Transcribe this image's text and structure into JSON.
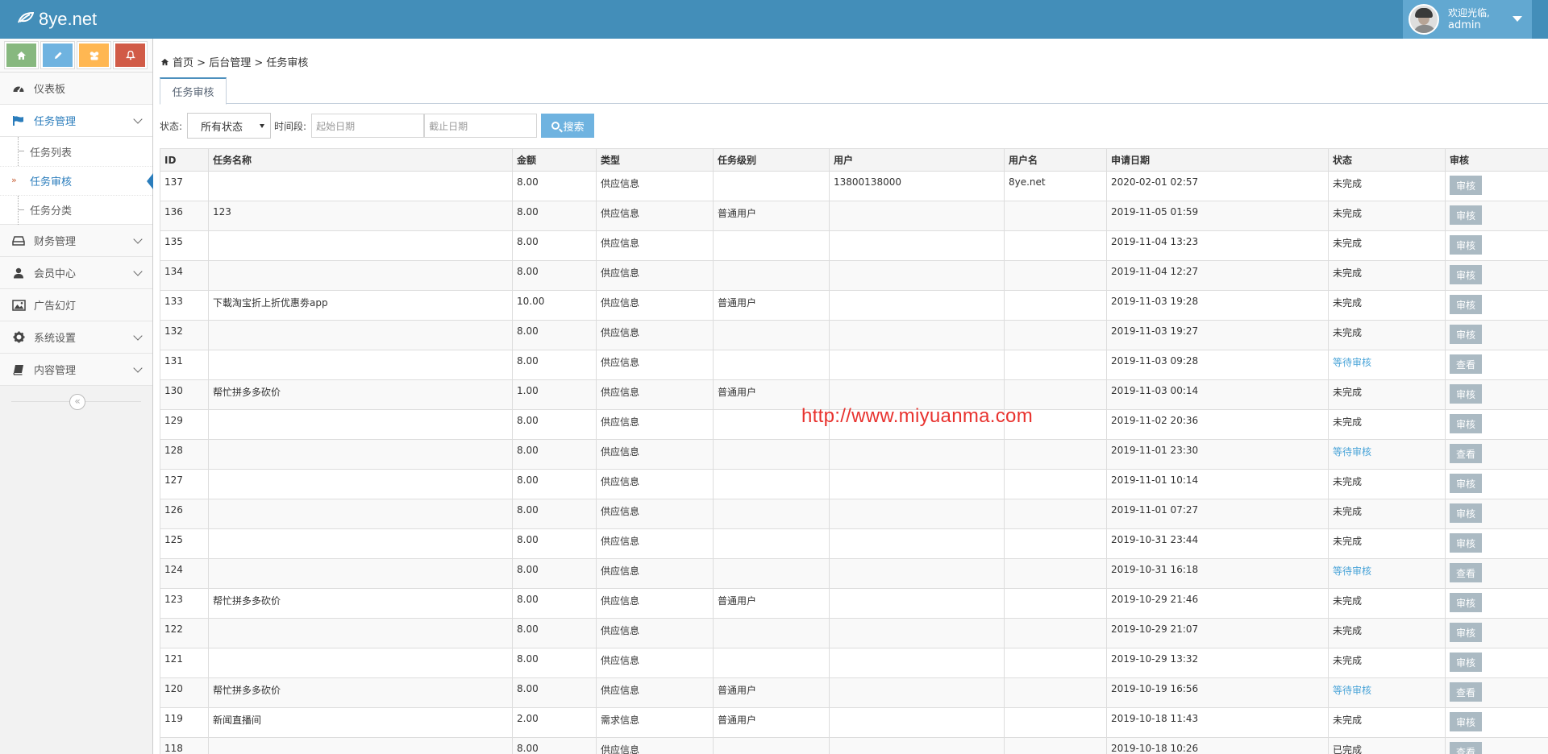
{
  "app": {
    "brand": "8ye.net"
  },
  "user": {
    "welcome": "欢迎光临,",
    "name": "admin"
  },
  "shortcuts": [
    "home-icon",
    "pencil-icon",
    "users-icon",
    "bell-icon"
  ],
  "sidebar": {
    "items": [
      {
        "label": "仪表板"
      },
      {
        "label": "任务管理"
      },
      {
        "label": "财务管理"
      },
      {
        "label": "会员中心"
      },
      {
        "label": "广告幻灯"
      },
      {
        "label": "系统设置"
      },
      {
        "label": "内容管理"
      }
    ],
    "sub": [
      "任务列表",
      "任务审核",
      "任务分类"
    ]
  },
  "breadcrumb": {
    "home": "首页",
    "sep1": ">",
    "level1": "后台管理",
    "sep2": ">",
    "current": "任务审核"
  },
  "tab": {
    "label": "任务审核"
  },
  "filter": {
    "status_label": "状态:",
    "status_value": "所有状态",
    "period_label": "时间段:",
    "start_placeholder": "起始日期",
    "end_placeholder": "截止日期",
    "search_label": "搜索"
  },
  "table": {
    "headers": [
      "ID",
      "任务名称",
      "金额",
      "类型",
      "任务级别",
      "用户",
      "用户名",
      "申请日期",
      "状态",
      "审核"
    ],
    "rows": [
      [
        "137",
        "",
        "8.00",
        "供应信息",
        "",
        "13800138000",
        "8ye.net",
        "2020-02-01 02:57",
        "未完成",
        "审核"
      ],
      [
        "136",
        "123",
        "8.00",
        "供应信息",
        "普通用户",
        "",
        "",
        "2019-11-05 01:59",
        "未完成",
        "审核"
      ],
      [
        "135",
        "",
        "8.00",
        "供应信息",
        "",
        "",
        "",
        "2019-11-04 13:23",
        "未完成",
        "审核"
      ],
      [
        "134",
        "",
        "8.00",
        "供应信息",
        "",
        "",
        "",
        "2019-11-04 12:27",
        "未完成",
        "审核"
      ],
      [
        "133",
        "下載淘宝折上折优惠劵app",
        "10.00",
        "供应信息",
        "普通用户",
        "",
        "",
        "2019-11-03 19:28",
        "未完成",
        "审核"
      ],
      [
        "132",
        "",
        "8.00",
        "供应信息",
        "",
        "",
        "",
        "2019-11-03 19:27",
        "未完成",
        "审核"
      ],
      [
        "131",
        "",
        "8.00",
        "供应信息",
        "",
        "",
        "",
        "2019-11-03 09:28",
        "等待审核",
        "查看"
      ],
      [
        "130",
        "帮忙拼多多砍价",
        "1.00",
        "供应信息",
        "普通用户",
        "",
        "",
        "2019-11-03 00:14",
        "未完成",
        "审核"
      ],
      [
        "129",
        "",
        "8.00",
        "供应信息",
        "",
        "",
        "",
        "2019-11-02 20:36",
        "未完成",
        "审核"
      ],
      [
        "128",
        "",
        "8.00",
        "供应信息",
        "",
        "",
        "",
        "2019-11-01 23:30",
        "等待审核",
        "查看"
      ],
      [
        "127",
        "",
        "8.00",
        "供应信息",
        "",
        "",
        "",
        "2019-11-01 10:14",
        "未完成",
        "审核"
      ],
      [
        "126",
        "",
        "8.00",
        "供应信息",
        "",
        "",
        "",
        "2019-11-01 07:27",
        "未完成",
        "审核"
      ],
      [
        "125",
        "",
        "8.00",
        "供应信息",
        "",
        "",
        "",
        "2019-10-31 23:44",
        "未完成",
        "审核"
      ],
      [
        "124",
        "",
        "8.00",
        "供应信息",
        "",
        "",
        "",
        "2019-10-31 16:18",
        "等待审核",
        "查看"
      ],
      [
        "123",
        "帮忙拼多多砍价",
        "8.00",
        "供应信息",
        "普通用户",
        "",
        "",
        "2019-10-29 21:46",
        "未完成",
        "审核"
      ],
      [
        "122",
        "",
        "8.00",
        "供应信息",
        "",
        "",
        "",
        "2019-10-29 21:07",
        "未完成",
        "审核"
      ],
      [
        "121",
        "",
        "8.00",
        "供应信息",
        "",
        "",
        "",
        "2019-10-29 13:32",
        "未完成",
        "审核"
      ],
      [
        "120",
        "帮忙拼多多砍价",
        "8.00",
        "供应信息",
        "普通用户",
        "",
        "",
        "2019-10-19 16:56",
        "等待审核",
        "查看"
      ],
      [
        "119",
        "新闻直播间",
        "2.00",
        "需求信息",
        "普通用户",
        "",
        "",
        "2019-10-18 11:43",
        "未完成",
        "审核"
      ],
      [
        "118",
        "",
        "8.00",
        "供应信息",
        "",
        "",
        "",
        "2019-10-18 10:26",
        "已完成",
        "查看"
      ]
    ]
  },
  "watermark": "http://www.miyuanma.com",
  "colors": {
    "navbar": "#438eb9",
    "accent": "#2b7dbc",
    "button": "#abbac3",
    "waiting": "#4aa4d8"
  }
}
